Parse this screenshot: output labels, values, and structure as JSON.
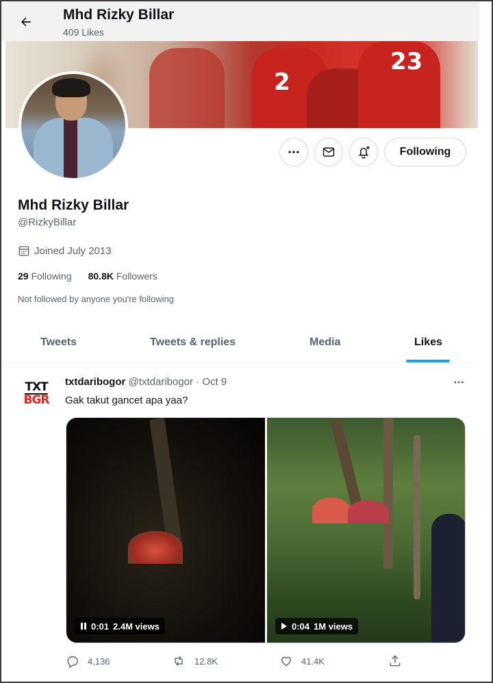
{
  "header": {
    "name": "Mhd Rizky Billar",
    "likes_count": "409 Likes"
  },
  "banner": {
    "jersey_numbers": [
      "2",
      "23"
    ]
  },
  "profile": {
    "name": "Mhd Rizky Billar",
    "handle": "@RizkyBillar",
    "joined": "Joined July 2013",
    "following_count": "29",
    "following_label": "Following",
    "followers_count": "80.8K",
    "followers_label": "Followers",
    "note": "Not followed by anyone you're following"
  },
  "actions": {
    "following_button": "Following"
  },
  "tabs": [
    {
      "label": "Tweets",
      "active": false
    },
    {
      "label": "Tweets & replies",
      "active": false
    },
    {
      "label": "Media",
      "active": false
    },
    {
      "label": "Likes",
      "active": true
    }
  ],
  "tweet": {
    "logo_top": "TXT",
    "logo_bottom": "BGR",
    "author_name": "txtdaribogor",
    "author_handle": "@txtdaribogor",
    "separator": "·",
    "date": "Oct 9",
    "text": "Gak takut gancet apa yaa?",
    "videos": [
      {
        "time": "0:01",
        "views": "2.4M views",
        "state": "paused"
      },
      {
        "time": "0:04",
        "views": "1M views",
        "state": "play"
      }
    ],
    "replies": "4,136",
    "retweets": "12.8K",
    "likes": "41.4K"
  },
  "colors": {
    "accent": "#1d9bf0",
    "text_primary": "#0f1419",
    "text_secondary": "#536471",
    "brand_red": "#e0261c"
  }
}
